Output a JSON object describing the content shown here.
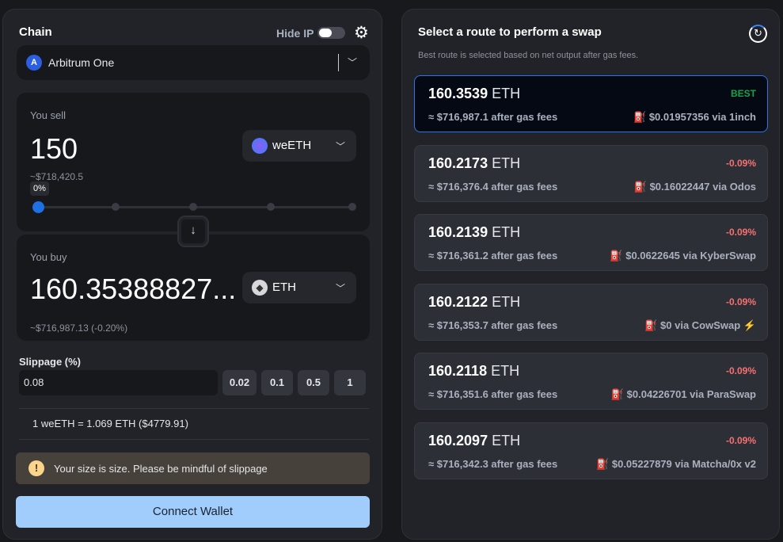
{
  "left": {
    "chain_label": "Chain",
    "hide_ip_label": "Hide IP",
    "chain_name": "Arbitrum One",
    "sell": {
      "label": "You sell",
      "amount": "150",
      "token": "weETH",
      "usd": "~$718,420.5",
      "percent": "0%"
    },
    "buy": {
      "label": "You buy",
      "amount": "160.35388827...",
      "token": "ETH",
      "usd": "~$716,987.13 (-0.20%)"
    },
    "slippage": {
      "label": "Slippage (%)",
      "value": "0.08",
      "presets": [
        "0.02",
        "0.1",
        "0.5",
        "1"
      ]
    },
    "rate": "1 weETH = 1.069 ETH ($4779.91)",
    "warning": "Your size is size. Please be mindful of slippage",
    "connect": "Connect Wallet"
  },
  "right": {
    "title": "Select a route to perform a swap",
    "subtitle": "Best route is selected based on net output after gas fees.",
    "routes": [
      {
        "amount": "160.3539",
        "unit": "ETH",
        "tag": "BEST",
        "usd": "≈ $716,987.1 after gas fees",
        "via": "$0.01957356 via 1inch"
      },
      {
        "amount": "160.2173",
        "unit": "ETH",
        "tag": "-0.09%",
        "usd": "≈ $716,376.4 after gas fees",
        "via": "$0.16022447 via Odos"
      },
      {
        "amount": "160.2139",
        "unit": "ETH",
        "tag": "-0.09%",
        "usd": "≈ $716,361.2 after gas fees",
        "via": "$0.0622645 via KyberSwap"
      },
      {
        "amount": "160.2122",
        "unit": "ETH",
        "tag": "-0.09%",
        "usd": "≈ $716,353.7 after gas fees",
        "via": "$0 via CowSwap"
      },
      {
        "amount": "160.2118",
        "unit": "ETH",
        "tag": "-0.09%",
        "usd": "≈ $716,351.6 after gas fees",
        "via": "$0.04226701 via ParaSwap"
      },
      {
        "amount": "160.2097",
        "unit": "ETH",
        "tag": "-0.09%",
        "usd": "≈ $716,342.3 after gas fees",
        "via": "$0.05227879 via Matcha/0x v2"
      }
    ]
  },
  "colors": {
    "best": "#16a34a",
    "negative": "#f87171",
    "accent": "#2f74e6"
  }
}
